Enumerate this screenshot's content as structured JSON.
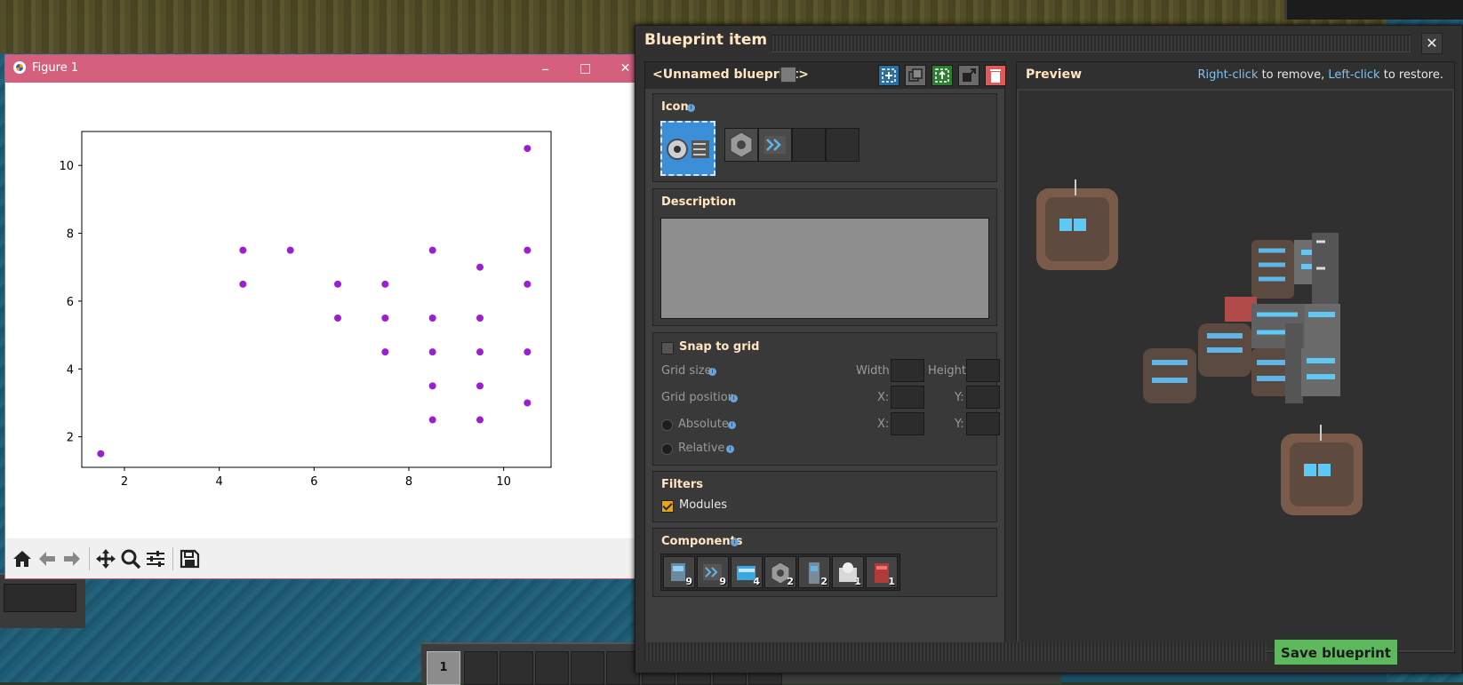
{
  "figure_window": {
    "title": "Figure 1",
    "minimize": "–",
    "maximize": "□",
    "close": "✕",
    "toolbar": [
      "home-icon",
      "back-icon",
      "forward-icon",
      "pan-icon",
      "zoom-icon",
      "configure-subplots-icon",
      "save-icon"
    ]
  },
  "chart_data": {
    "type": "scatter",
    "title": "",
    "xlabel": "",
    "ylabel": "",
    "xlim": [
      1.1,
      11.0
    ],
    "ylim": [
      1.1,
      11.0
    ],
    "xticks": [
      2,
      4,
      6,
      8,
      10
    ],
    "yticks": [
      2,
      4,
      6,
      8,
      10
    ],
    "grid": false,
    "color": "#9b1fd1",
    "points": [
      [
        1.5,
        1.5
      ],
      [
        4.5,
        7.5
      ],
      [
        4.5,
        6.5
      ],
      [
        5.5,
        7.5
      ],
      [
        6.5,
        6.5
      ],
      [
        6.5,
        5.5
      ],
      [
        7.5,
        6.5
      ],
      [
        7.5,
        5.5
      ],
      [
        7.5,
        4.5
      ],
      [
        8.5,
        7.5
      ],
      [
        8.5,
        5.5
      ],
      [
        8.5,
        4.5
      ],
      [
        8.5,
        3.5
      ],
      [
        8.5,
        2.5
      ],
      [
        9.5,
        7.0
      ],
      [
        9.5,
        5.5
      ],
      [
        9.5,
        4.5
      ],
      [
        9.5,
        3.5
      ],
      [
        9.5,
        2.5
      ],
      [
        10.5,
        10.5
      ],
      [
        10.5,
        7.5
      ],
      [
        10.5,
        6.5
      ],
      [
        10.5,
        4.5
      ],
      [
        10.5,
        3.0
      ]
    ]
  },
  "dialog": {
    "title": "Blueprint item",
    "close": "✕",
    "blueprint_name": "<Unnamed blueprint>",
    "icon_section": "Icon",
    "description_section": "Description",
    "description_value": "",
    "snap_to_grid": "Snap to grid",
    "grid_size": "Grid size",
    "width_label": "Width:",
    "height_label": "Height:",
    "grid_position": "Grid position",
    "x_label": "X:",
    "y_label": "Y:",
    "absolute": "Absolute",
    "relative": "Relative",
    "filters_section": "Filters",
    "modules_label": "Modules",
    "components_section": "Components",
    "components": [
      {
        "icon": "pipe-to-ground-icon",
        "count": "9"
      },
      {
        "icon": "express-transport-belt-icon",
        "count": "9"
      },
      {
        "icon": "storage-tank-icon",
        "count": "4"
      },
      {
        "icon": "electric-mining-drill-icon",
        "count": "2"
      },
      {
        "icon": "pump-icon",
        "count": "2"
      },
      {
        "icon": "chemical-plant-icon",
        "count": "1"
      },
      {
        "icon": "offshore-pump-icon",
        "count": "1"
      }
    ],
    "preview_title": "Preview",
    "hint_right_click": "Right-click",
    "hint_to_remove": "to remove,",
    "hint_left_click": "Left-click",
    "hint_to_restore": "to restore.",
    "save_button": "Save blueprint"
  },
  "quickbar": {
    "selected_slot": "1"
  }
}
